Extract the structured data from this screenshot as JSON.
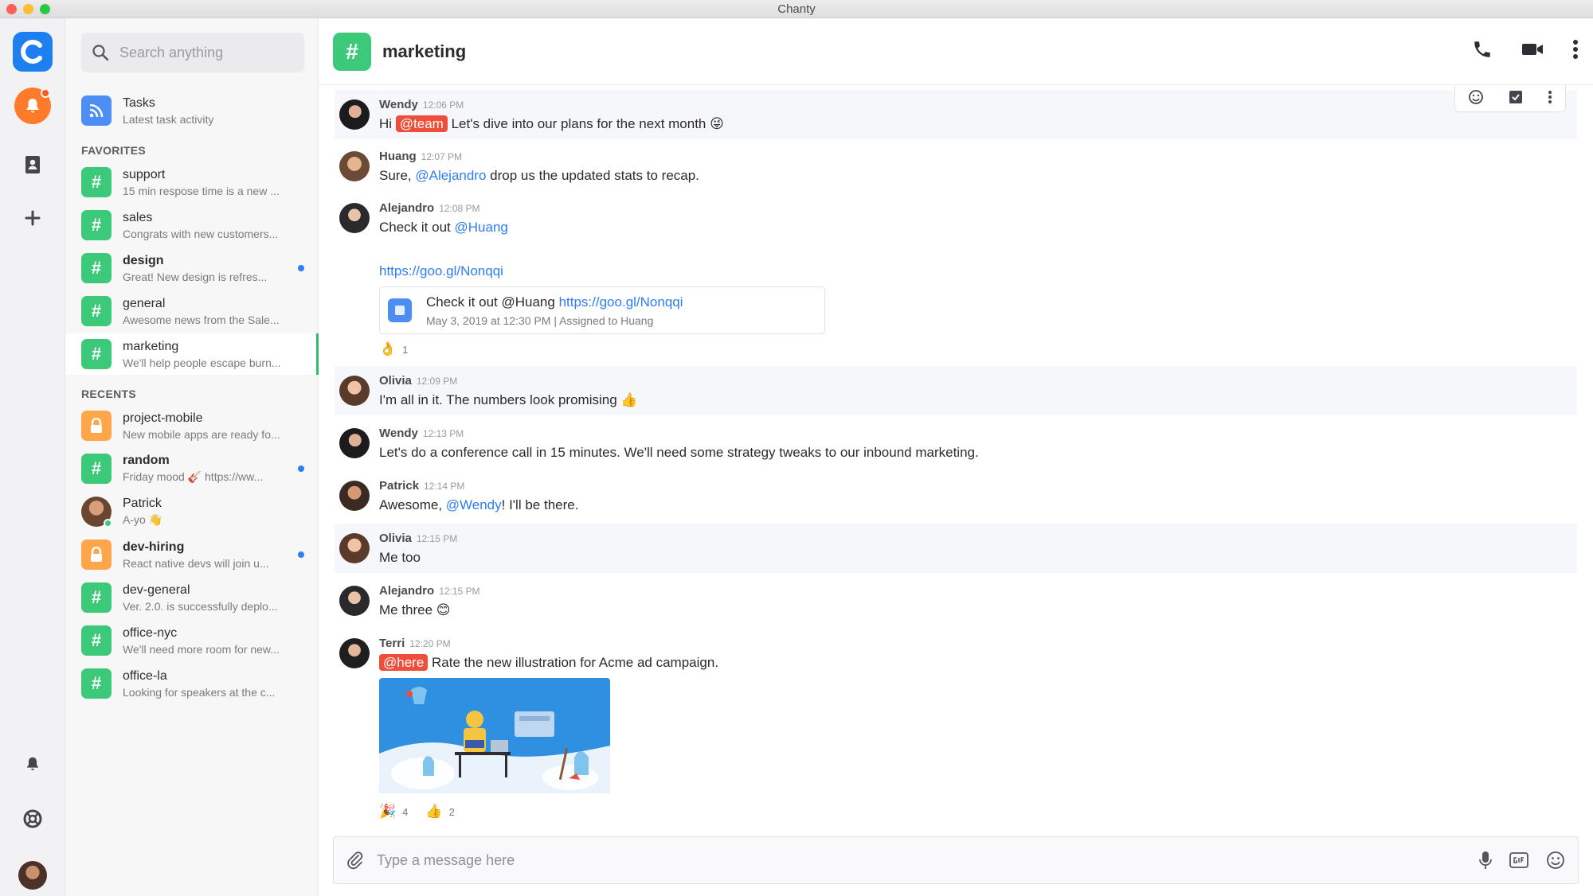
{
  "window": {
    "title": "Chanty"
  },
  "search": {
    "placeholder": "Search anything"
  },
  "sidebar": {
    "tasks": {
      "name": "Tasks",
      "preview": "Latest task activity"
    },
    "favorites_label": "FAVORITES",
    "favorites": [
      {
        "name": "support",
        "preview": "15 min respose time is a new ...",
        "bold": false,
        "unread": false
      },
      {
        "name": "sales",
        "preview": "Congrats with new customers...",
        "bold": false,
        "unread": false
      },
      {
        "name": "design",
        "preview": "Great! New design is refres...",
        "bold": true,
        "unread": true
      },
      {
        "name": "general",
        "preview": "Awesome news from the Sale...",
        "bold": false,
        "unread": false
      },
      {
        "name": "marketing",
        "preview": "We'll help people escape burn...",
        "bold": false,
        "unread": false,
        "active": true
      }
    ],
    "recents_label": "RECENTS",
    "recents": [
      {
        "name": "project-mobile",
        "preview": "New mobile apps are ready fo...",
        "type": "private"
      },
      {
        "name": "random",
        "preview": "Friday mood 🎸 https://ww...",
        "type": "channel",
        "bold": true,
        "unread": true
      },
      {
        "name": "Patrick",
        "preview": "A-yo 👋",
        "type": "person"
      },
      {
        "name": "dev-hiring",
        "preview": "React native devs will join u...",
        "type": "private",
        "bold": true,
        "unread": true
      },
      {
        "name": "dev-general",
        "preview": "Ver. 2.0. is successfully deplo...",
        "type": "channel"
      },
      {
        "name": "office-nyc",
        "preview": "We'll need more room for new...",
        "type": "channel"
      },
      {
        "name": "office-la",
        "preview": "Looking for speakers at the c...",
        "type": "channel"
      }
    ]
  },
  "channel": {
    "name": "marketing",
    "hash": "#"
  },
  "messages": [
    {
      "author": "Wendy",
      "time": "12:06 PM",
      "pre": "Hi ",
      "pill": "@team",
      "post": " Let's dive into our plans for the next month 😜"
    },
    {
      "author": "Huang",
      "time": "12:07 PM",
      "pre": "Sure, ",
      "mention": "@Alejandro",
      "post": " drop us the updated stats to recap."
    },
    {
      "author": "Alejandro",
      "time": "12:08 PM",
      "pre": "Check it out ",
      "mention": "@Huang",
      "post": "",
      "link": "https://goo.gl/Nonqqi",
      "task": {
        "title_pre": "Check it out @Huang ",
        "title_link": "https://goo.gl/Nonqqi",
        "sub": "May 3, 2019 at 12:30 PM  |  Assigned to  Huang"
      },
      "reactions": [
        {
          "emoji": "👌",
          "count": "1"
        }
      ]
    },
    {
      "author": "Olivia",
      "time": "12:09 PM",
      "pre": "I'm all in it. The numbers look promising 👍"
    },
    {
      "author": "Wendy",
      "time": "12:13 PM",
      "pre": "Let's do a conference call in 15 minutes. We'll need some strategy tweaks to our inbound marketing."
    },
    {
      "author": "Patrick",
      "time": "12:14 PM",
      "pre": "Awesome, ",
      "mention": "@Wendy",
      "post": "! I'll be there."
    },
    {
      "author": "Olivia",
      "time": "12:15 PM",
      "pre": "Me too"
    },
    {
      "author": "Alejandro",
      "time": "12:15 PM",
      "pre": "Me three 😊"
    },
    {
      "author": "Terri",
      "time": "12:20 PM",
      "pill": "@here",
      "post": " Rate the new illustration for Acme ad campaign.",
      "reactions": [
        {
          "emoji": "🎉",
          "count": "4"
        },
        {
          "emoji": "👍",
          "count": "2"
        }
      ]
    }
  ],
  "composer": {
    "placeholder": "Type a message here"
  },
  "colors": {
    "accent_green": "#3cc97a",
    "brand_blue": "#1e7ff0",
    "mention_red": "#ef4e3a",
    "link_blue": "#2f7df6",
    "notify_orange": "#ff7b2c"
  }
}
